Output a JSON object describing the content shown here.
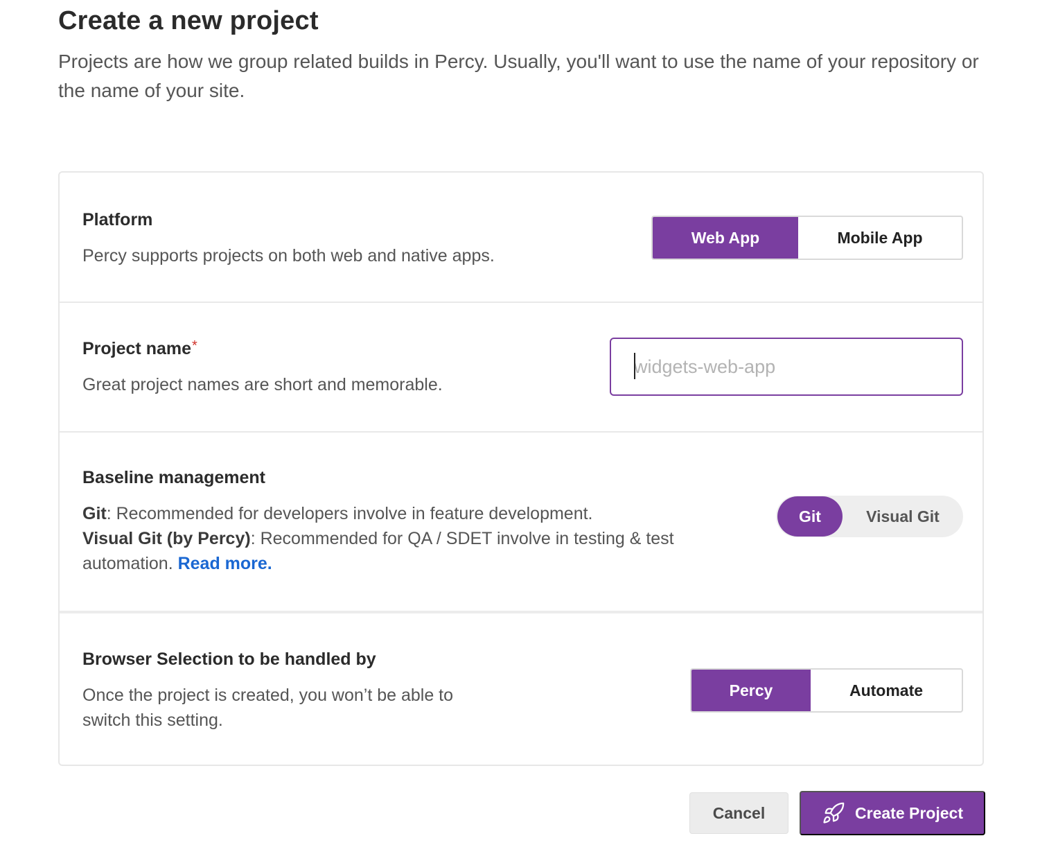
{
  "header": {
    "title": "Create a new project",
    "description": "Projects are how we group related builds in Percy. Usually, you'll want to use the name of your repository or the name of your site."
  },
  "platform": {
    "title": "Platform",
    "description": "Percy supports projects on both web and native apps.",
    "options": [
      "Web App",
      "Mobile App"
    ],
    "selected": "Web App"
  },
  "project_name": {
    "title": "Project name",
    "required_mark": "*",
    "description": "Great project names are short and memorable.",
    "value": "",
    "placeholder": "widgets-web-app"
  },
  "baseline": {
    "title": "Baseline management",
    "git_label": "Git",
    "git_text": ": Recommended for developers involve in feature development.",
    "visual_git_label": "Visual Git (by Percy)",
    "visual_git_text": ": Recommended for QA / SDET involve in testing & test automation.",
    "read_more": "Read more.",
    "options": [
      "Git",
      "Visual Git"
    ],
    "selected": "Git"
  },
  "browser_selection": {
    "title": "Browser Selection to be handled by",
    "description": "Once the project is created, you won’t be able to switch this setting.",
    "options": [
      "Percy",
      "Automate"
    ],
    "selected": "Percy"
  },
  "actions": {
    "cancel_label": "Cancel",
    "create_label": "Create Project",
    "create_icon": "rocket-icon"
  },
  "colors": {
    "accent": "#7a3ea0",
    "link": "#1a67d2",
    "required": "#d0332b"
  }
}
